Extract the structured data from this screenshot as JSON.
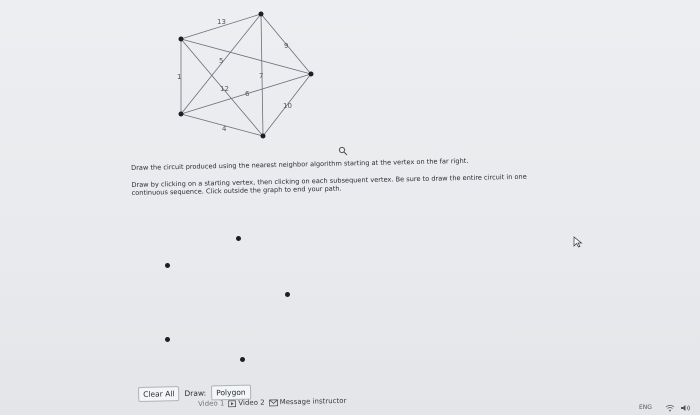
{
  "graph": {
    "edge_weights": [
      "13",
      "9",
      "5",
      "7",
      "1",
      "12",
      "6",
      "10",
      "4"
    ]
  },
  "instructions": {
    "line1": "Draw the circuit produced using the nearest neighbor algorithm starting at the vertex on the far right.",
    "line2": "Draw by clicking on a starting vertex, then clicking on each subsequent vertex. Be sure to draw the entire circuit in one continuous sequence. Click outside the graph to end your path."
  },
  "toolbar": {
    "clear_label": "Clear All",
    "draw_label": "Draw:",
    "mode_label": "Polygon"
  },
  "links": {
    "partial_label": "Video 1",
    "video2_label": "Video 2",
    "message_label": "Message instructor"
  },
  "taskbar": {
    "language": "ENG"
  },
  "icons": {
    "search": "search-icon",
    "pointer": "mouse-pointer-icon",
    "video": "video-icon",
    "message": "mail-icon",
    "wifi": "wifi-icon",
    "speaker": "speaker-icon"
  },
  "colors": {
    "background": "#e9ebee",
    "text": "#2b2f36",
    "vertex": "#1d1f24"
  }
}
